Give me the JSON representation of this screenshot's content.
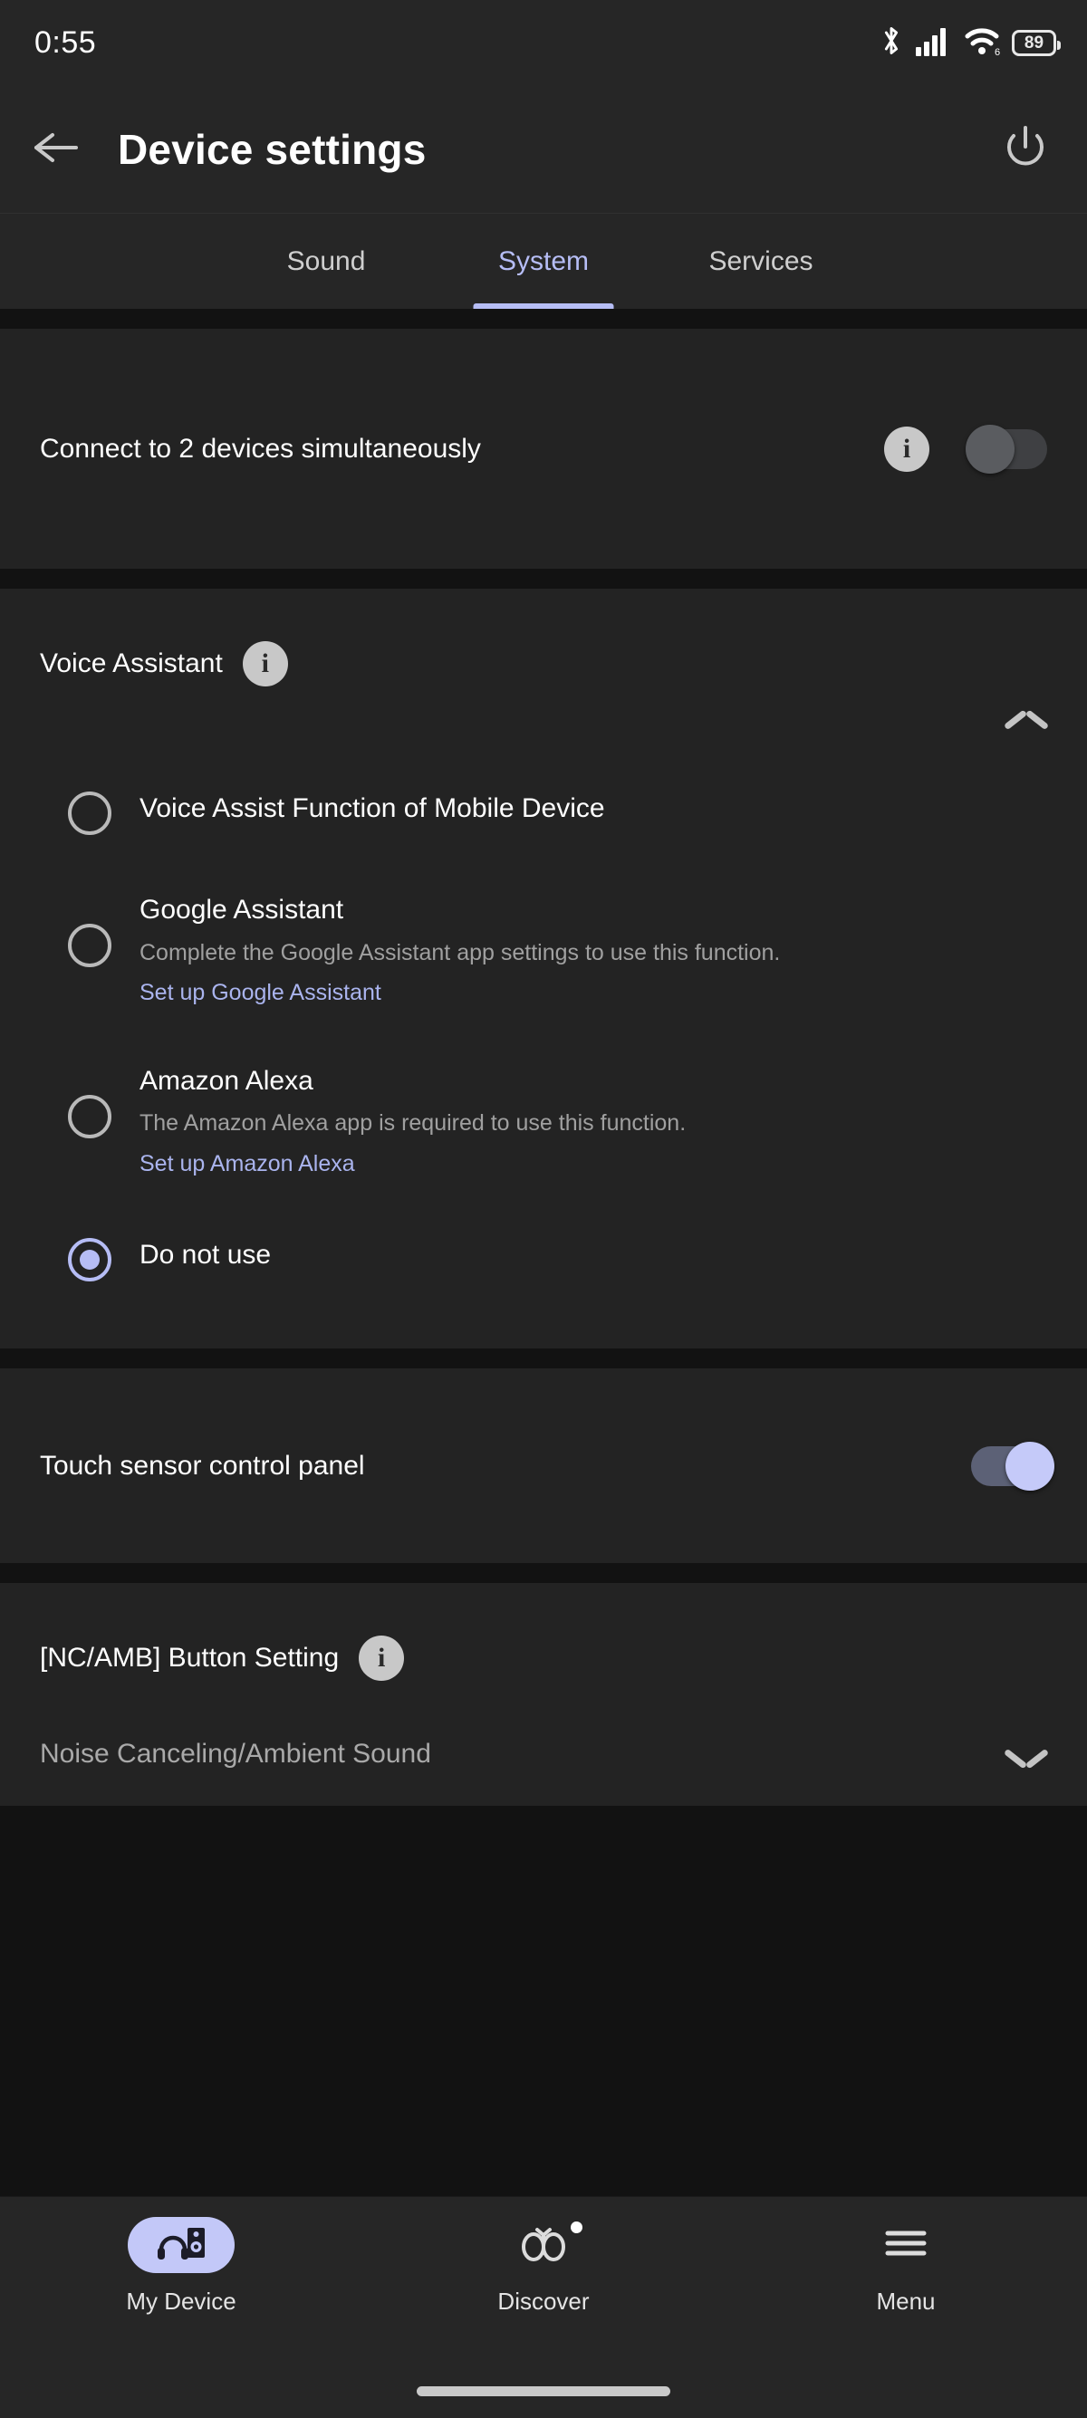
{
  "statusbar": {
    "time": "0:55",
    "battery_level": "89",
    "icons": [
      "bluetooth-icon",
      "cellular-signal-icon",
      "wifi-icon",
      "battery-icon"
    ]
  },
  "appbar": {
    "title": "Device settings",
    "back_icon": "back-arrow-icon",
    "power_icon": "power-icon"
  },
  "tabs": {
    "items": [
      {
        "label": "Sound",
        "active": false
      },
      {
        "label": "System",
        "active": true
      },
      {
        "label": "Services",
        "active": false
      }
    ],
    "active_color": "#b6bdf5"
  },
  "multipoint": {
    "label": "Connect to 2 devices simultaneously",
    "info_icon": "info-icon",
    "toggle_state": "off"
  },
  "voice_assistant": {
    "title": "Voice Assistant",
    "info_icon": "info-icon",
    "collapse_icon": "chevron-up-icon",
    "options": [
      {
        "title": "Voice Assist Function of Mobile Device",
        "description": "",
        "link": "",
        "selected": false
      },
      {
        "title": "Google Assistant",
        "description": "Complete the Google Assistant app settings to use this function.",
        "link": "Set up Google Assistant",
        "selected": false
      },
      {
        "title": "Amazon Alexa",
        "description": "The Amazon Alexa app is required to use this function.",
        "link": "Set up Amazon Alexa",
        "selected": false
      },
      {
        "title": "Do not use",
        "description": "",
        "link": "",
        "selected": true
      }
    ]
  },
  "touch_sensor": {
    "label": "Touch sensor control panel",
    "toggle_state": "on"
  },
  "nc_amb": {
    "title": "[NC/AMB] Button Setting",
    "info_icon": "info-icon",
    "value": "Noise Canceling/Ambient Sound",
    "expand_icon": "chevron-down-icon"
  },
  "bottomnav": {
    "items": [
      {
        "label": "My Device",
        "icon": "headphones-device-icon",
        "active": true,
        "badge": false
      },
      {
        "label": "Discover",
        "icon": "binoculars-icon",
        "active": false,
        "badge": true
      },
      {
        "label": "Menu",
        "icon": "hamburger-menu-icon",
        "active": false,
        "badge": false
      }
    ]
  },
  "colors": {
    "accent": "#b6bdf5",
    "card": "#232323",
    "background": "#121212",
    "chrome": "#262626"
  }
}
